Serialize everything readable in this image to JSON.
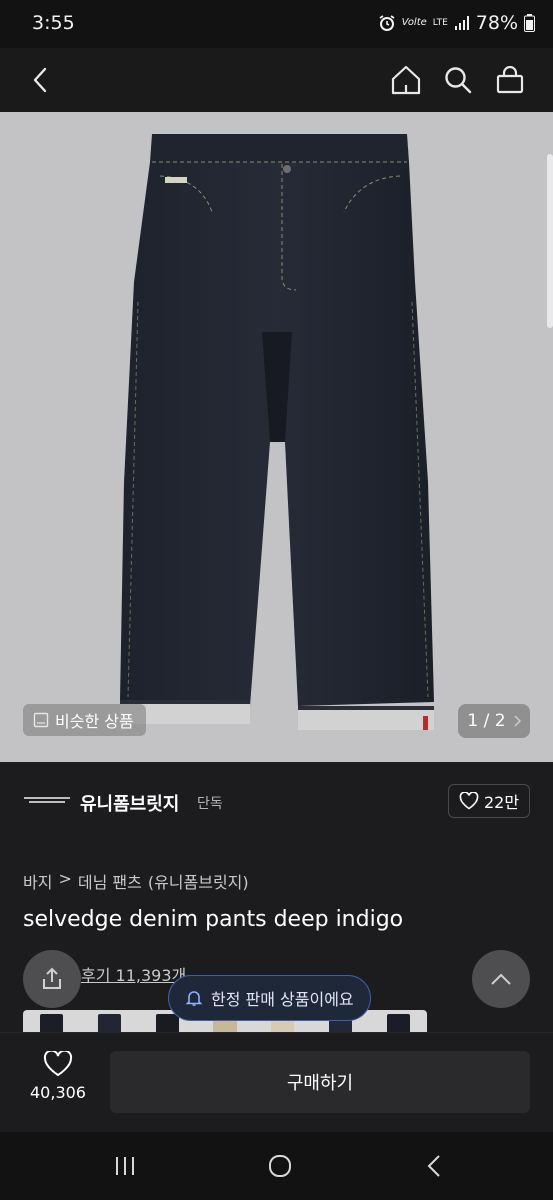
{
  "status": {
    "time": "3:55",
    "volte": "Volte",
    "lte": "LTE",
    "battery": "78%"
  },
  "product": {
    "similar_label": "비슷한 상품",
    "pager": "1 / 2",
    "brand_name": "유니폼브릿지",
    "brand_tag": "단독",
    "likes": "22만",
    "breadcrumb": [
      "바지",
      "데님 팬츠",
      "(유니폼브릿지)"
    ],
    "title": "selvedge denim pants deep indigo",
    "reviews": "후기 11,393개",
    "limited_notice": "한정 판매 상품이에요",
    "thumb_colors": [
      "#1b1e26",
      "#222634",
      "#191b22",
      "#c9b79a",
      "#d7cbb3",
      "#22283a",
      "#1a1d27"
    ]
  },
  "bottom": {
    "wish_count": "40,306",
    "buy_label": "구매하기"
  },
  "colors": {
    "background": "#1c1c1e",
    "hero_bg": "#c3c3c5",
    "notice_border": "#3f5fa8"
  }
}
